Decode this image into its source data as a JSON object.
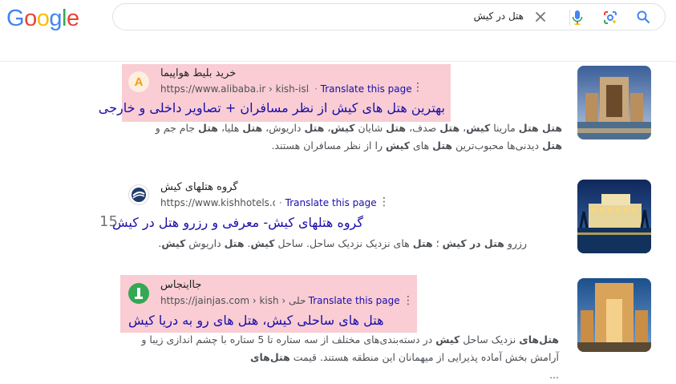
{
  "logo": {
    "letters": [
      "G",
      "o",
      "o",
      "g",
      "l",
      "e"
    ],
    "colors": [
      "#4285F4",
      "#EA4335",
      "#FBBC05",
      "#4285F4",
      "#34A853",
      "#EA4335"
    ]
  },
  "search": {
    "query": "هتل در کیش"
  },
  "icons": {
    "clear": "close-icon",
    "voice": "mic-icon",
    "lens": "lens-icon",
    "search": "search-icon"
  },
  "page_number": "15",
  "results": [
    {
      "site_name": "خرید بلیط هواپیما",
      "url": "https://www.alibaba.ir › kish-island",
      "translate": "Translate this page",
      "title": "بهترین هتل های کیش از نظر مسافران + تصاویر داخلی و خارجی",
      "snippet_line1": [
        {
          "t": "هتل هتل",
          "b": true
        },
        {
          "t": " مارینا ",
          "b": false
        },
        {
          "t": "کیش",
          "b": true
        },
        {
          "t": "، ",
          "b": false
        },
        {
          "t": "هتل",
          "b": true
        },
        {
          "t": " صدف، ",
          "b": false
        },
        {
          "t": "هتل",
          "b": true
        },
        {
          "t": " شایان ",
          "b": false
        },
        {
          "t": "کیش",
          "b": true
        },
        {
          "t": "، ",
          "b": false
        },
        {
          "t": "هتل",
          "b": true
        },
        {
          "t": " داریوش، ",
          "b": false
        },
        {
          "t": "هتل",
          "b": true
        },
        {
          "t": " هلیا، ",
          "b": false
        },
        {
          "t": "هتل",
          "b": true
        },
        {
          "t": " جام جم و",
          "b": false
        }
      ],
      "snippet_line2": [
        {
          "t": "هتل",
          "b": true
        },
        {
          "t": " دیدنی‌ها محبوب‌ترین ",
          "b": false
        },
        {
          "t": "هتل",
          "b": true
        },
        {
          "t": " های ",
          "b": false
        },
        {
          "t": "کیش",
          "b": true
        },
        {
          "t": " را از نظر مسافران هستند.",
          "b": false
        }
      ]
    },
    {
      "site_name": "گروه هتلهای کیش",
      "url": "https://www.kishhotels.org",
      "translate": "Translate this page",
      "title": "گروه هتلهای کیش- معرفی و رزرو هتل در کیش",
      "snippet_line1": [
        {
          "t": "رزرو ",
          "b": false
        },
        {
          "t": "هتل در کیش",
          "b": true
        },
        {
          "t": " ؛ ",
          "b": false
        },
        {
          "t": "هتل",
          "b": true
        },
        {
          "t": " های نزدیک نزدیک ساحل. ساحل ",
          "b": false
        },
        {
          "t": "کیش",
          "b": true
        },
        {
          "t": ". ",
          "b": false
        },
        {
          "t": "هتل",
          "b": true
        },
        {
          "t": " داریوش ",
          "b": false
        },
        {
          "t": "کیش",
          "b": true
        },
        {
          "t": ".",
          "b": false
        }
      ],
      "snippet_line2": []
    },
    {
      "site_name": "جااینجاس",
      "url": "https://jainjas.com › kish › حلی",
      "translate": "Translate this page",
      "title": "هتل های ساحلی کیش، هتل های رو به دریا کیش",
      "snippet_line1": [
        {
          "t": "هتل‌های",
          "b": true
        },
        {
          "t": " نزدیک ساحل ",
          "b": false
        },
        {
          "t": "کیش",
          "b": true
        },
        {
          "t": " در دسته‌بندی‌های مختلف از سه ستاره تا 5 ستاره با چشم اندازی زیبا و",
          "b": false
        }
      ],
      "snippet_line2": [
        {
          "t": "آرامش بخش آماده پذیرایی از میهمانان این منطقه هستند. قیمت ",
          "b": false
        },
        {
          "t": "هتل‌های",
          "b": true
        }
      ],
      "snippet_line3": "..."
    }
  ],
  "colors": {
    "highlight": "#f9cdd3",
    "link": "#1a0dab",
    "translate": "#1a0dab"
  }
}
